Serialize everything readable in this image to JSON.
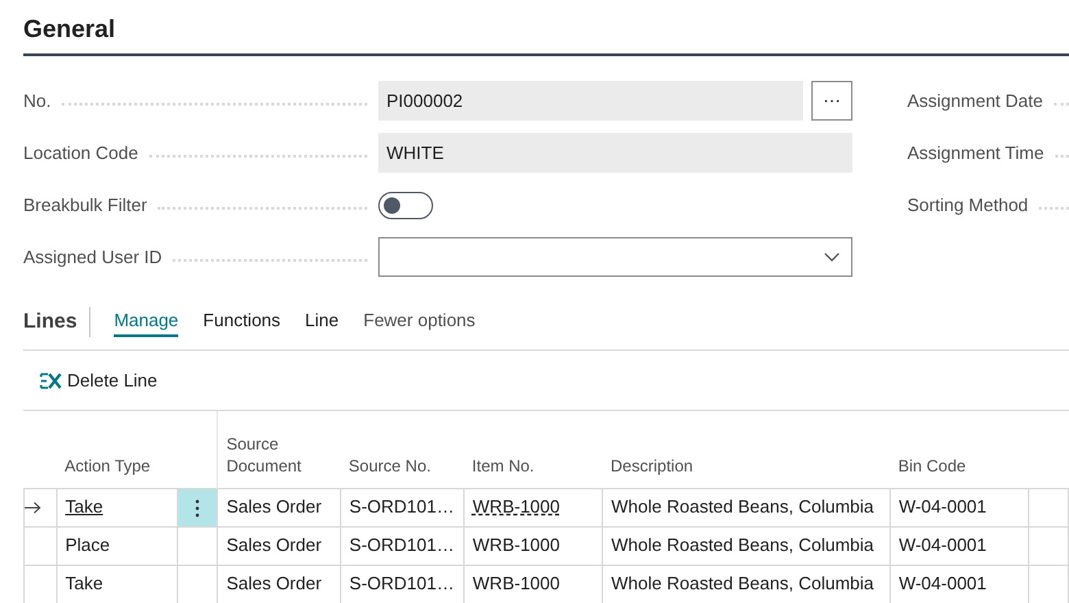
{
  "section": {
    "title": "General"
  },
  "fields": [
    {
      "label": "No.",
      "kind": "lookup",
      "value": "PI000002",
      "button": "⋯"
    },
    {
      "label": "Location Code",
      "kind": "text",
      "value": "WHITE"
    },
    {
      "label": "Breakbulk Filter",
      "kind": "toggle",
      "on": false
    },
    {
      "label": "Assigned User ID",
      "kind": "dropdown"
    }
  ],
  "side_fields": [
    {
      "label": "Assignment Date"
    },
    {
      "label": "Assignment Time"
    },
    {
      "label": "Sorting Method"
    }
  ],
  "lines": {
    "title": "Lines",
    "tabs": [
      {
        "label": "Manage",
        "selected": true
      },
      {
        "label": "Functions",
        "selected": false
      },
      {
        "label": "Line",
        "selected": false
      }
    ],
    "options_link": "Fewer options",
    "actions": [
      {
        "label": "Delete Line"
      }
    ],
    "columns": [
      "Action Type",
      "Source Document",
      "Source No.",
      "Item No.",
      "Description",
      "Bin Code"
    ],
    "rows": [
      {
        "selected": true,
        "cells": [
          "Take",
          "Sales Order",
          "S-ORD101…",
          "WRB-1000",
          "Whole Roasted Beans, Columbia",
          "W-04-0001"
        ]
      },
      {
        "selected": false,
        "cells": [
          "Place",
          "Sales Order",
          "S-ORD101…",
          "WRB-1000",
          "Whole Roasted Beans, Columbia",
          "W-04-0001"
        ]
      },
      {
        "selected": false,
        "cells": [
          "Take",
          "Sales Order",
          "S-ORD101…",
          "WRB-1000",
          "Whole Roasted Beans, Columbia",
          "W-04-0001"
        ]
      }
    ]
  }
}
